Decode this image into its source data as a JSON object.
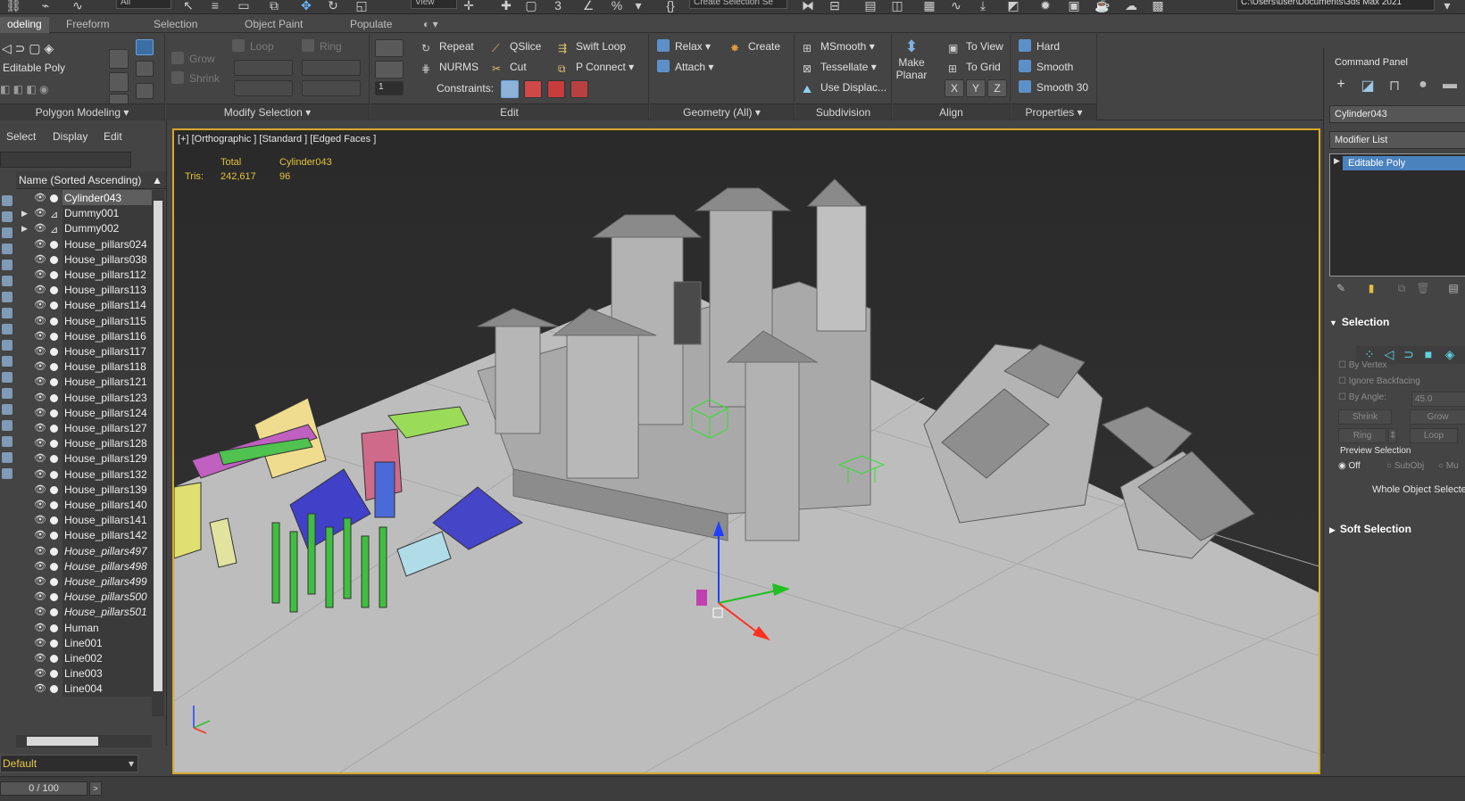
{
  "topbar": {
    "view_dropdown": "View",
    "selection_set": "Create Selection Se",
    "project_path": "C:\\Users\\user\\Documents\\3ds Max 2021"
  },
  "ribbon_tabs": [
    "odeling",
    "Freeform",
    "Selection",
    "Object Paint",
    "Populate"
  ],
  "ribbon": {
    "polygon_modeling": {
      "object_label": "Editable Poly",
      "title": "Polygon Modeling"
    },
    "modify_selection": {
      "grow": "Grow",
      "shrink": "Shrink",
      "loop": "Loop",
      "ring": "Ring",
      "title": "Modify Selection"
    },
    "edit": {
      "repeat": "Repeat",
      "qslice": "QSlice",
      "swift_loop": "Swift Loop",
      "nurms": "NURMS",
      "cut": "Cut",
      "p_connect": "P Connect",
      "constraints": "Constraints:",
      "spinner_value": "1",
      "title": "Edit"
    },
    "geometry": {
      "relax": "Relax",
      "create": "Create",
      "attach": "Attach",
      "title": "Geometry (All)"
    },
    "subdivision": {
      "msmooth": "MSmooth",
      "tessellate": "Tessellate",
      "use_displac": "Use Displac...",
      "title": "Subdivision"
    },
    "align": {
      "make_planar_1": "Make",
      "make_planar_2": "Planar",
      "to_view": "To View",
      "to_grid": "To Grid",
      "x": "X",
      "y": "Y",
      "z": "Z",
      "title": "Align"
    },
    "properties": {
      "hard": "Hard",
      "smooth": "Smooth",
      "smooth30": "Smooth 30",
      "title": "Properties"
    }
  },
  "explorer": {
    "menu": {
      "select": "Select",
      "display": "Display",
      "edit": "Edit"
    },
    "column_header": "Name (Sorted Ascending)",
    "items": [
      {
        "name": "Cylinder043",
        "selected": true
      },
      {
        "name": "Dummy001",
        "group": true
      },
      {
        "name": "Dummy002",
        "group": true
      },
      {
        "name": "House_pillars024"
      },
      {
        "name": "House_pillars038"
      },
      {
        "name": "House_pillars112"
      },
      {
        "name": "House_pillars113"
      },
      {
        "name": "House_pillars114"
      },
      {
        "name": "House_pillars115"
      },
      {
        "name": "House_pillars116"
      },
      {
        "name": "House_pillars117"
      },
      {
        "name": "House_pillars118"
      },
      {
        "name": "House_pillars121"
      },
      {
        "name": "House_pillars123"
      },
      {
        "name": "House_pillars124"
      },
      {
        "name": "House_pillars127"
      },
      {
        "name": "House_pillars128"
      },
      {
        "name": "House_pillars129"
      },
      {
        "name": "House_pillars132"
      },
      {
        "name": "House_pillars139"
      },
      {
        "name": "House_pillars140"
      },
      {
        "name": "House_pillars141"
      },
      {
        "name": "House_pillars142"
      },
      {
        "name": "House_pillars497",
        "instance": true
      },
      {
        "name": "House_pillars498",
        "instance": true
      },
      {
        "name": "House_pillars499",
        "instance": true
      },
      {
        "name": "House_pillars500",
        "instance": true
      },
      {
        "name": "House_pillars501",
        "instance": true
      },
      {
        "name": "Human"
      },
      {
        "name": "Line001"
      },
      {
        "name": "Line002"
      },
      {
        "name": "Line003"
      },
      {
        "name": "Line004"
      }
    ],
    "layer": "Default"
  },
  "viewport": {
    "label": "[+] [Orthographic ] [Standard ] [Edged Faces ]",
    "stats": {
      "total_label": "Total",
      "object_label": "Cylinder043",
      "tris_label": "Tris:",
      "tris_total": "242,617",
      "tris_object": "96"
    },
    "colors": {
      "border": "#d9a826",
      "stats_text": "#e2c23a",
      "ground": "#bdbdbd",
      "buildings": "#a9a9a9"
    }
  },
  "command_panel": {
    "title": "Command Panel",
    "object_name": "Cylinder043",
    "modifier_list": "Modifier List",
    "stack_item": "Editable Poly",
    "selection": {
      "title": "Selection",
      "by_vertex": "By Vertex",
      "ignore_backfacing": "Ignore Backfacing",
      "by_angle": "By Angle:",
      "angle_value": "45.0",
      "shrink": "Shrink",
      "grow": "Grow",
      "ring": "Ring",
      "loop": "Loop",
      "preview_selection": "Preview Selection",
      "off": "Off",
      "subobj": "SubObj",
      "multi": "Mu",
      "whole_object": "Whole Object Selecte"
    },
    "soft_selection": "Soft Selection"
  },
  "timeline": {
    "frame": "0 / 100"
  }
}
